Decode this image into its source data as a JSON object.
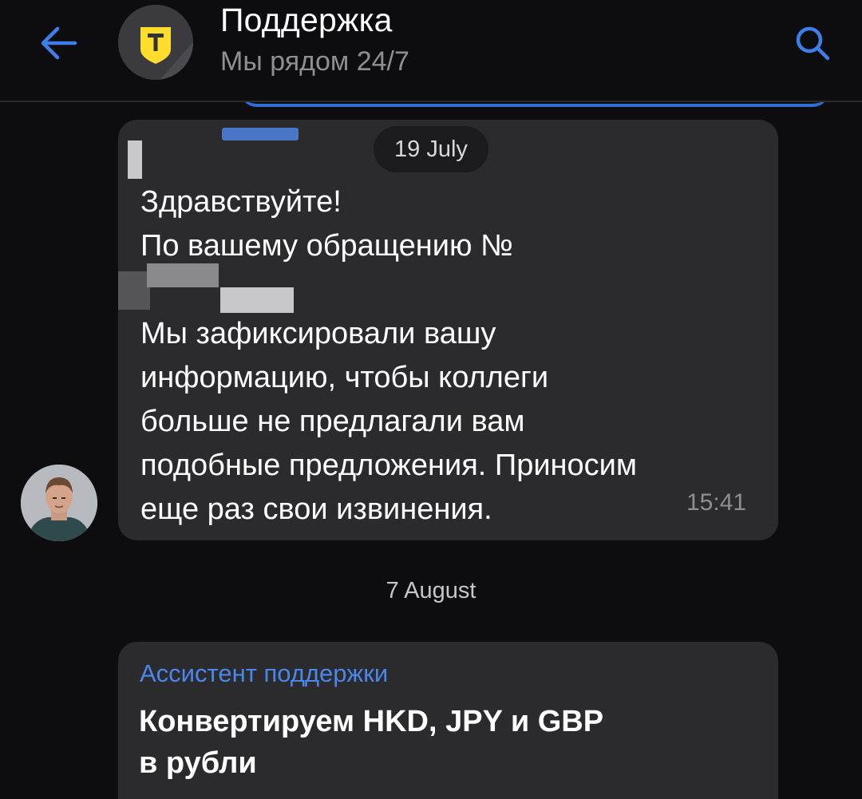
{
  "header": {
    "title": "Поддержка",
    "subtitle": "Мы рядом 24/7",
    "back_icon": "arrow-left-icon",
    "search_icon": "search-icon",
    "avatar_logo_letter": "т"
  },
  "messages": [
    {
      "date": "19 July",
      "lines": [
        "Здравствуйте!",
        "По вашему обращению №",
        "",
        "Мы зафиксировали вашу",
        "информацию, чтобы коллеги",
        "больше не предлагали вам",
        "подобные предложения. Приносим",
        "еще раз свои извинения."
      ],
      "time": "15:41"
    },
    {
      "date": "7 August",
      "sender": "Ассистент поддержки",
      "headline_line1": "Конвертируем HKD, JPY и GBP",
      "headline_line2": "в рубли"
    }
  ],
  "colors": {
    "background": "#0d0d0f",
    "bubble": "#2b2b2e",
    "accent_blue": "#4b87ea",
    "brand_yellow": "#ffdd2d",
    "muted_text": "#8e8e93"
  }
}
